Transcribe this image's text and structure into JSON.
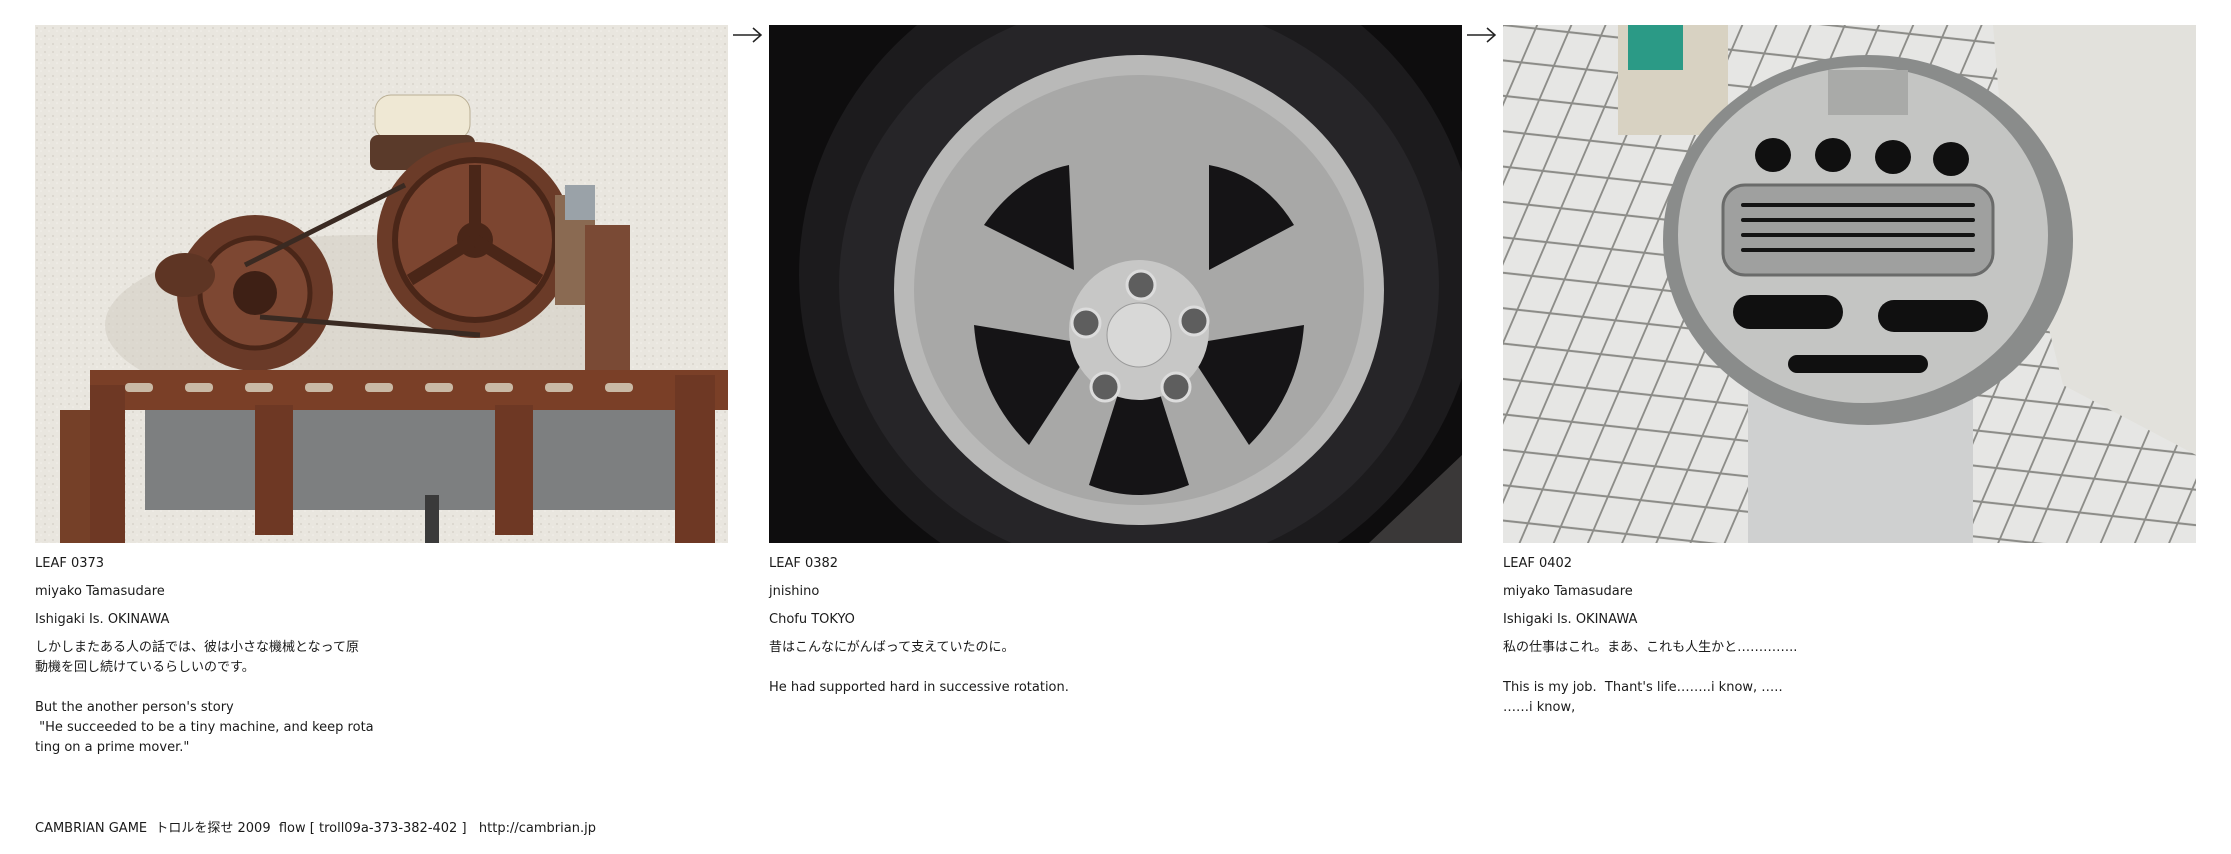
{
  "panels": [
    {
      "id": "LEAF 0373",
      "author": "miyako Tamasudare",
      "location": "Ishigaki Is. OKINAWA",
      "ja_lines": [
        "しかしまたある人の話では、彼は小さな機械となって原",
        "動機を回し続けているらしいのです。"
      ],
      "en_lines": [
        "But the another person's story",
        " \"He succeeded to be a tiny machine, and keep rota",
        "ting on a prime mover.\""
      ],
      "photo_icon": "rusty-machine-photo"
    },
    {
      "id": "LEAF 0382",
      "author": "jnishino",
      "location": "Chofu TOKYO",
      "ja_lines": [
        "昔はこんなにがんばって支えていたのに。"
      ],
      "en_lines": [
        "He had supported hard in successive rotation."
      ],
      "photo_icon": "car-wheel-photo"
    },
    {
      "id": "LEAF 0402",
      "author": "miyako Tamasudare",
      "location": "Ishigaki Is. OKINAWA",
      "ja_lines": [
        "私の仕事はこれ。まあ、これも人生かと………….."
      ],
      "en_lines": [
        "This is my job.  Thant's life……..i know, …..",
        "……i know,"
      ],
      "photo_icon": "ashtray-photo"
    }
  ],
  "arrows": [
    "arrow-right-icon",
    "arrow-right-icon"
  ],
  "footer": "CAMBRIAN GAME  トロルを探せ 2009  flow [ troll09a-373-382-402 ]   http://cambrian.jp"
}
